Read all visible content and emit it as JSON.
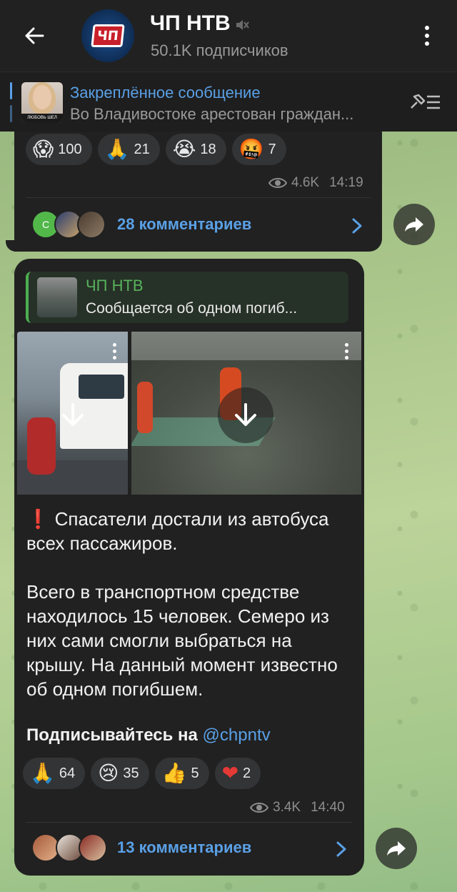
{
  "header": {
    "title": "ЧП НТВ",
    "subscribers": "50.1K подписчиков",
    "avatar_logo": "ЧП"
  },
  "pinned": {
    "title": "Закреплённое сообщение",
    "preview": "Во Владивостоке арестован граждан...",
    "thumb_caption": "ЛЮБОВЬ ШЕЛ"
  },
  "post1": {
    "reactions": [
      {
        "emoji": "😱",
        "count": "100"
      },
      {
        "emoji": "🙏",
        "count": "21"
      },
      {
        "emoji": "😭",
        "count": "18"
      },
      {
        "emoji": "🤬",
        "count": "7"
      }
    ],
    "views": "4.6K",
    "time": "14:19",
    "comments": "28 комментариев",
    "comment_avatar_letter": "С"
  },
  "post2": {
    "quote_title": "ЧП НТВ",
    "quote_text": "Сообщается об одном погиб...",
    "emoji_lead": "❗",
    "paragraph1": "Спасатели достали из автобуса всех пассажиров.",
    "paragraph2": "Всего в транспортном средстве находилось 15 человек. Семеро из них сами смогли выбраться на крышу. На данный момент известно об одном погибшем.",
    "subscribe_text": "Подписывайтесь на ",
    "subscribe_link": "@chpntv",
    "reactions": [
      {
        "emoji": "🙏",
        "count": "64"
      },
      {
        "emoji": "😢",
        "count": "35"
      },
      {
        "emoji": "👍",
        "count": "5"
      },
      {
        "emoji": "❤",
        "count": "2"
      }
    ],
    "views": "3.4K",
    "time": "14:40",
    "comments": "13 комментариев"
  }
}
